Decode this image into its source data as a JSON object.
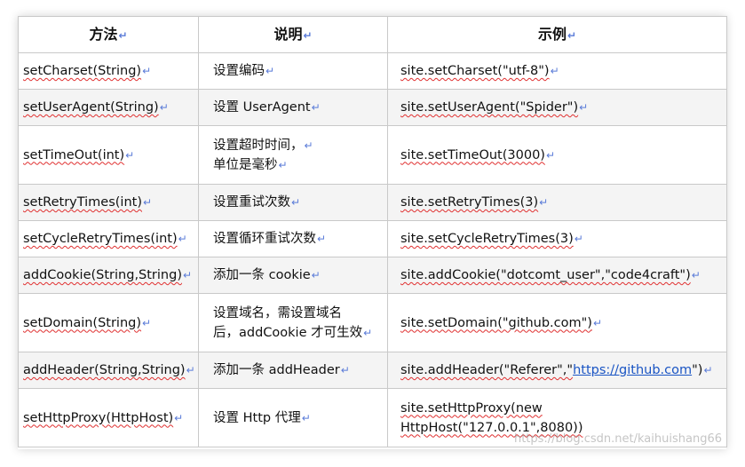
{
  "headers": {
    "method": "方法",
    "desc": "说明",
    "example": "示例"
  },
  "return_mark": "↵",
  "rows": [
    {
      "method": "setCharset(String)",
      "desc": "设置编码",
      "example": "site.setCharset(\"utf-8\")"
    },
    {
      "method": "setUserAgent(String)",
      "desc": "设置 UserAgent",
      "example": "site.setUserAgent(\"Spider\")"
    },
    {
      "method": "setTimeOut(int)",
      "desc1": "设置超时时间，",
      "desc2": "单位是毫秒",
      "example": "site.setTimeOut(3000)"
    },
    {
      "method": "setRetryTimes(int)",
      "desc": "设置重试次数",
      "example": "site.setRetryTimes(3)"
    },
    {
      "method": "setCycleRetryTimes(int)",
      "desc": "设置循环重试次数",
      "example": "site.setCycleRetryTimes(3)"
    },
    {
      "method": "addCookie(String,String)",
      "desc": "添加一条 cookie",
      "example": "site.addCookie(\"dotcomt_user\",\"code4craft\")"
    },
    {
      "method": "setDomain(String)",
      "desc1": "设置域名，需设置域名",
      "desc2": "后，addCookie 才可生效",
      "example": "site.setDomain(\"github.com\")"
    },
    {
      "method": "addHeader(String,String)",
      "desc": "添加一条 addHeader",
      "example_pre": "site.addHeader(\"Referer\",\"",
      "example_link": "https://github.com",
      "example_post": "\")"
    },
    {
      "method": "setHttpProxy(HttpHost)",
      "desc": "设置 Http 代理",
      "example1": "site.setHttpProxy(new",
      "example2": "HttpHost(\"127.0.0.1\",8080))"
    }
  ],
  "watermark": "https://blog.csdn.net/kaihuishang66"
}
